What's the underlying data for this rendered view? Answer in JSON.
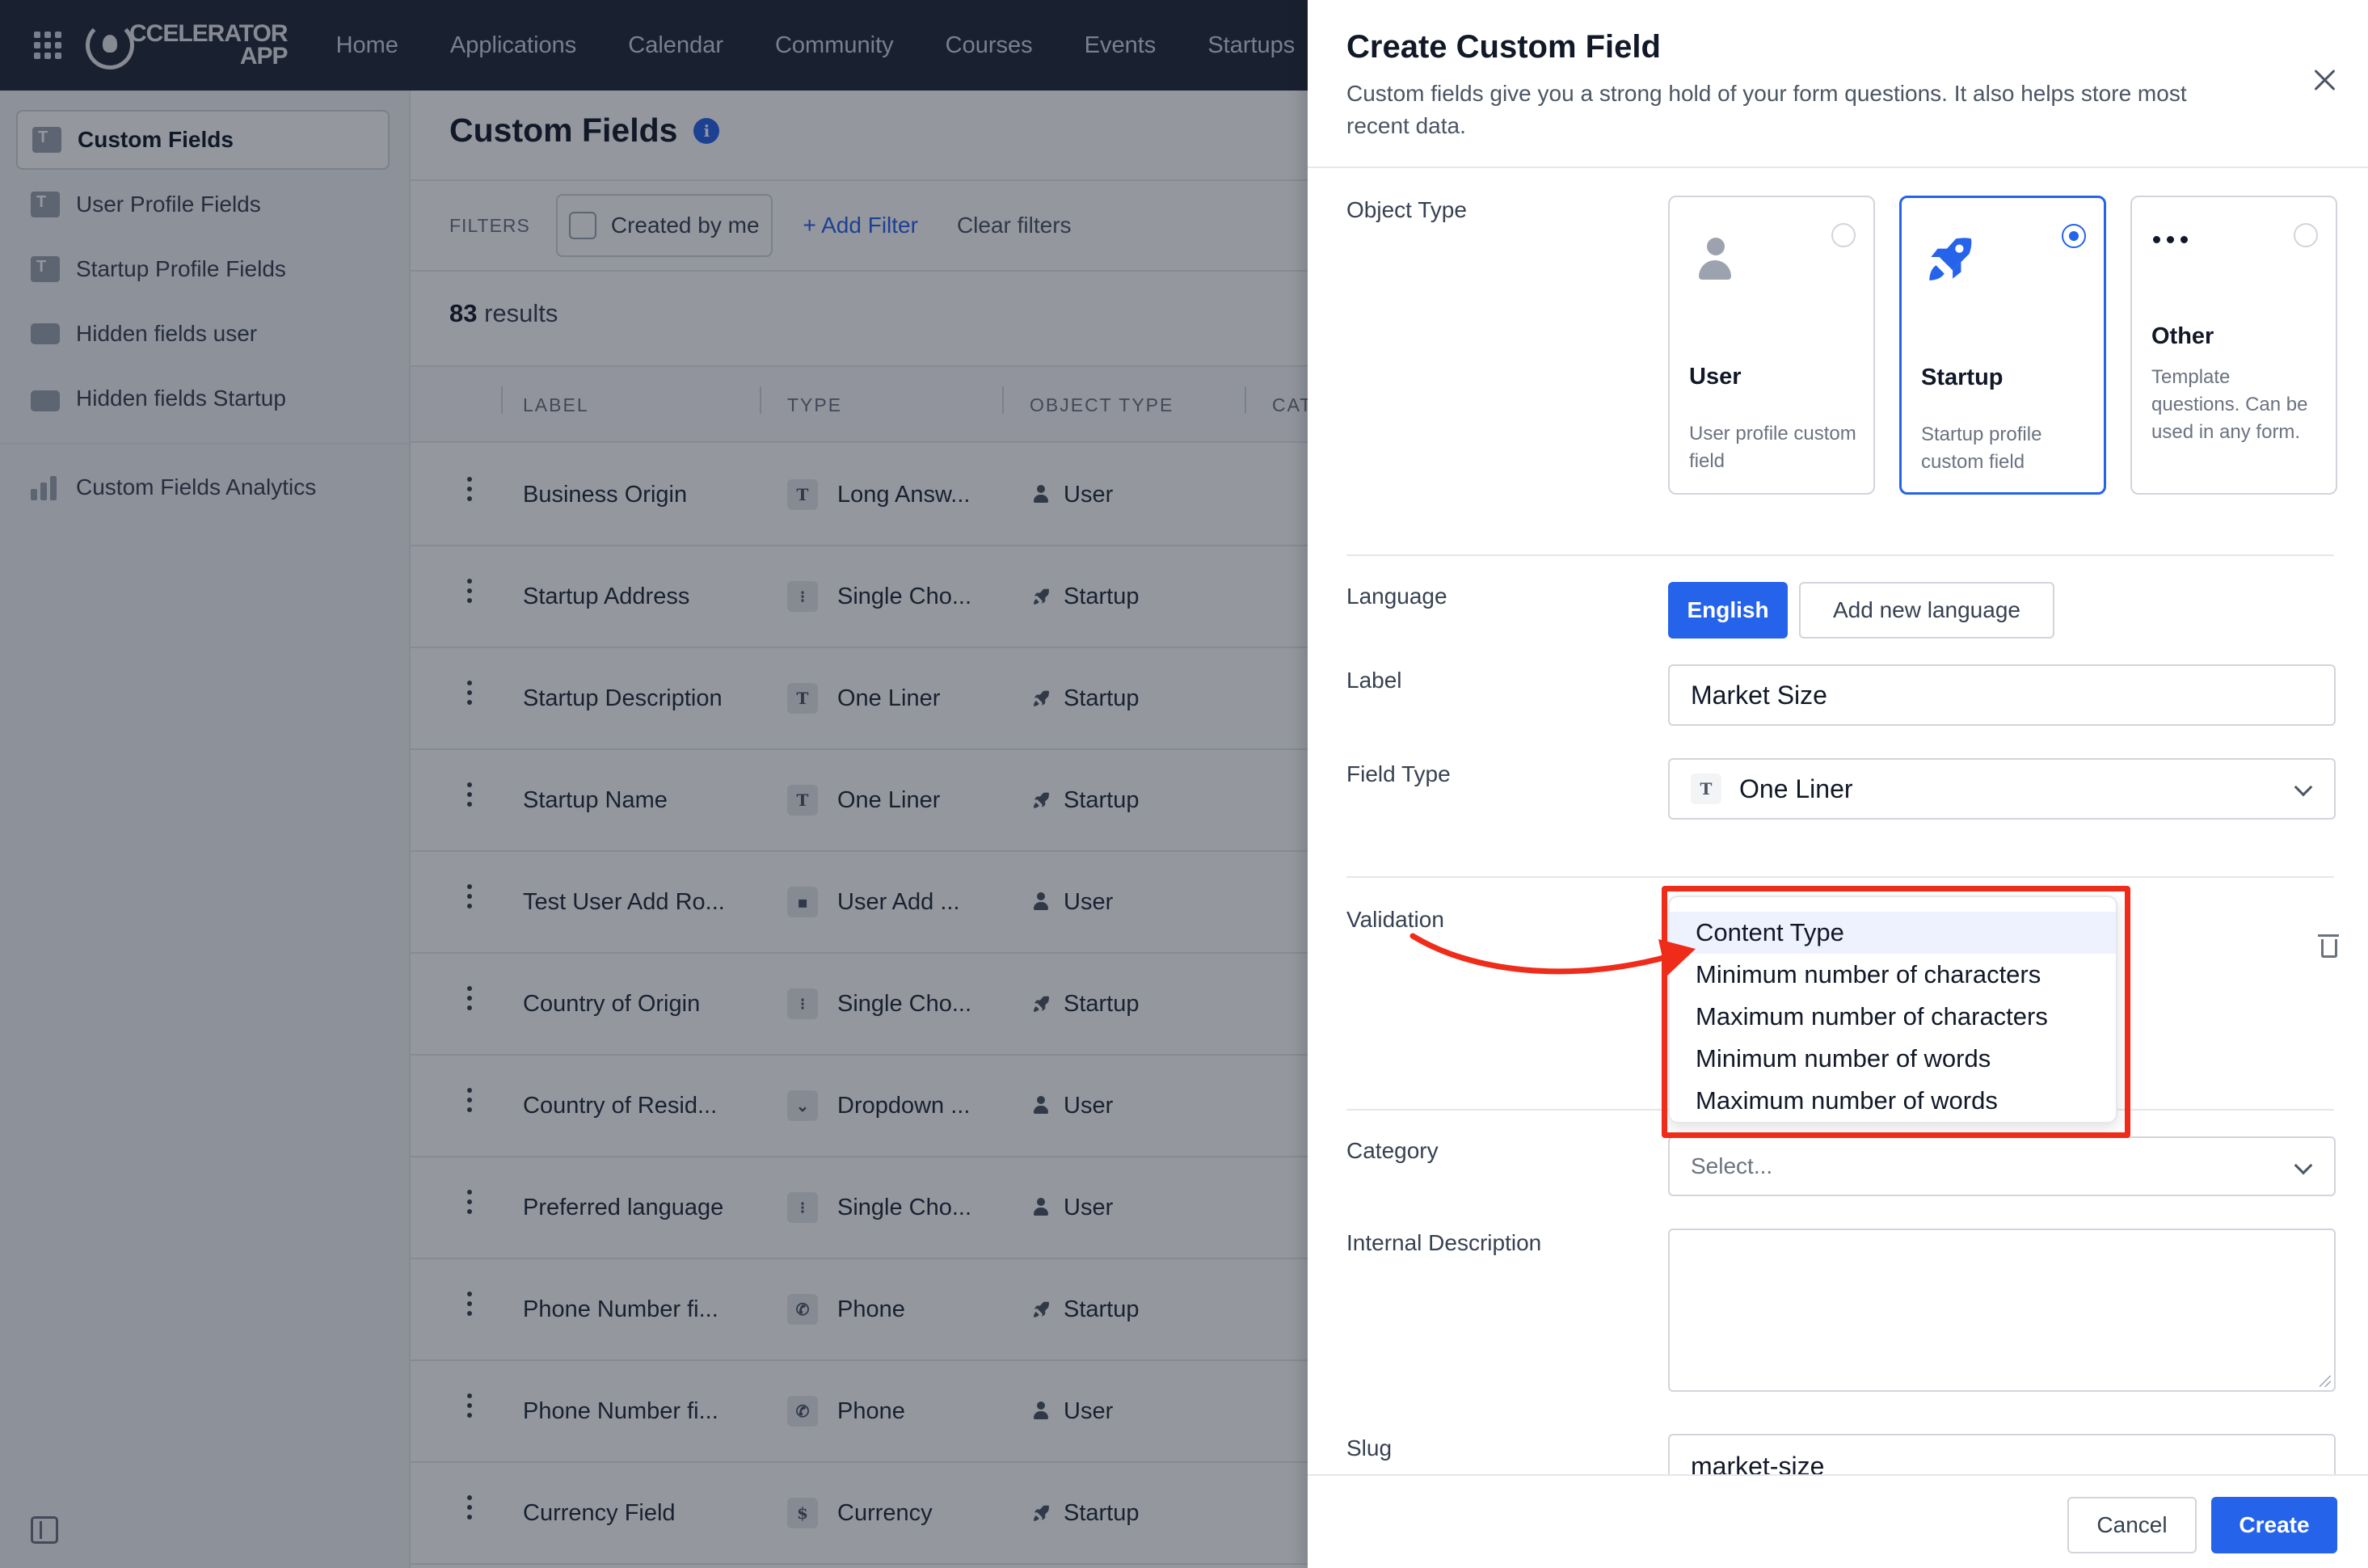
{
  "topbar": {
    "logo_line1": "CCELERATOR",
    "logo_line2": "APP",
    "nav": [
      "Home",
      "Applications",
      "Calendar",
      "Community",
      "Courses",
      "Events",
      "Startups"
    ]
  },
  "sidebar": {
    "items": [
      {
        "label": "Custom Fields",
        "icon": "custom-fields-icon",
        "active": true
      },
      {
        "label": "User Profile Fields",
        "icon": "user-profile-fields-icon"
      },
      {
        "label": "Startup Profile Fields",
        "icon": "startup-profile-fields-icon"
      },
      {
        "label": "Hidden fields user",
        "icon": "id-card-icon"
      },
      {
        "label": "Hidden fields Startup",
        "icon": "briefcase-icon"
      },
      {
        "label": "Custom Fields Analytics",
        "icon": "bar-chart-icon"
      }
    ]
  },
  "main": {
    "title": "Custom Fields",
    "filters_label": "FILTERS",
    "created_by_me": "Created by me",
    "add_filter": "Add Filter",
    "clear_filters": "Clear filters",
    "results_count": "83",
    "results_label": "results",
    "columns": [
      "LABEL",
      "TYPE",
      "OBJECT TYPE",
      "CAT"
    ],
    "rows": [
      {
        "label": "Business Origin",
        "type_icon": "T",
        "type": "Long Answ...",
        "object": "User"
      },
      {
        "label": "Startup Address",
        "type_icon": "⁝",
        "type": "Single Cho...",
        "object": "Startup"
      },
      {
        "label": "Startup Description",
        "type_icon": "T",
        "type": "One Liner",
        "object": "Startup"
      },
      {
        "label": "Startup Name",
        "type_icon": "T",
        "type": "One Liner",
        "object": "Startup"
      },
      {
        "label": "Test User Add Ro...",
        "type_icon": "▪",
        "type": "User Add ...",
        "object": "User"
      },
      {
        "label": "Country of Origin",
        "type_icon": "⁝",
        "type": "Single Cho...",
        "object": "Startup"
      },
      {
        "label": "Country of Resid...",
        "type_icon": "⌄",
        "type": "Dropdown ...",
        "object": "User"
      },
      {
        "label": "Preferred language",
        "type_icon": "⁝",
        "type": "Single Cho...",
        "object": "User"
      },
      {
        "label": "Phone Number fi...",
        "type_icon": "✆",
        "type": "Phone",
        "object": "Startup"
      },
      {
        "label": "Phone Number fi...",
        "type_icon": "✆",
        "type": "Phone",
        "object": "User"
      },
      {
        "label": "Currency Field",
        "type_icon": "$",
        "type": "Currency",
        "object": "Startup"
      }
    ]
  },
  "drawer": {
    "title": "Create Custom Field",
    "subtitle": "Custom fields give you a strong hold of your form questions. It also helps store most recent data.",
    "object_type_label": "Object Type",
    "object_types": [
      {
        "title": "User",
        "desc": "User profile custom field",
        "selected": false
      },
      {
        "title": "Startup",
        "desc": "Startup profile custom field",
        "selected": true
      },
      {
        "title": "Other",
        "desc": "Template questions. Can be used in any form.",
        "selected": false
      }
    ],
    "language_label": "Language",
    "language_active": "English",
    "add_language": "Add new language",
    "label_label": "Label",
    "label_value": "Market Size",
    "field_type_label": "Field Type",
    "field_type_icon": "T",
    "field_type_value": "One Liner",
    "validation_label": "Validation",
    "validation_options": [
      "Content Type",
      "Minimum number of characters",
      "Maximum number of characters",
      "Minimum number of words",
      "Maximum number of words"
    ],
    "category_label": "Category",
    "category_placeholder": "Select...",
    "internal_description_label": "Internal Description",
    "slug_label": "Slug",
    "slug_value": "market-size",
    "cancel": "Cancel",
    "create": "Create"
  },
  "colors": {
    "accent": "#2563eb",
    "topbar": "#1f2937",
    "annotation": "#ef2b1a"
  }
}
